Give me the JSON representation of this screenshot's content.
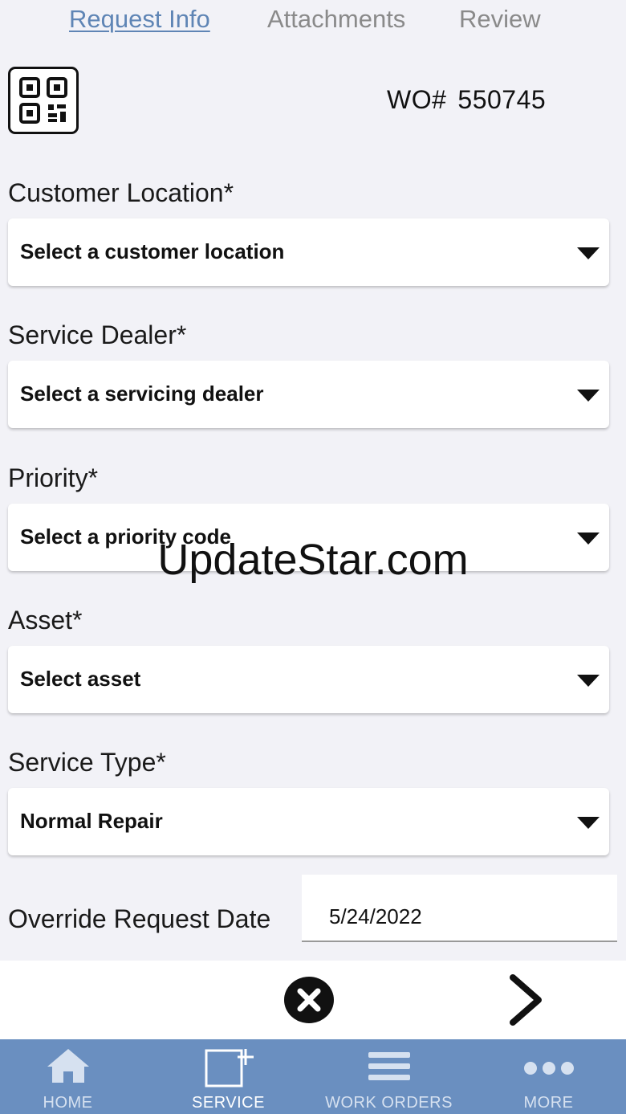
{
  "tabs": [
    {
      "label": "Request Info",
      "active": true
    },
    {
      "label": "Attachments",
      "active": false
    },
    {
      "label": "Review",
      "active": false
    }
  ],
  "header": {
    "qr_icon": "qr-code-icon",
    "wo_prefix": "WO#",
    "wo_number": "550745"
  },
  "form": {
    "customer_location": {
      "label": "Customer Location*",
      "value": "Select a customer location"
    },
    "service_dealer": {
      "label": "Service Dealer*",
      "value": "Select a servicing dealer"
    },
    "priority": {
      "label": "Priority*",
      "value": "Select a priority code"
    },
    "asset": {
      "label": "Asset*",
      "value": "Select asset"
    },
    "service_type": {
      "label": "Service Type*",
      "value": "Normal Repair"
    },
    "override_date": {
      "label": "Override Request Date",
      "value": "5/24/2022"
    }
  },
  "actions": {
    "cancel_icon": "close-circle-icon",
    "next_icon": "chevron-right-icon"
  },
  "nav": [
    {
      "label": "HOME",
      "icon": "home-icon",
      "active": false
    },
    {
      "label": "SERVICE",
      "icon": "new-service-icon",
      "active": true
    },
    {
      "label": "WORK ORDERS",
      "icon": "list-icon",
      "active": false
    },
    {
      "label": "MORE",
      "icon": "more-dots-icon",
      "active": false
    }
  ],
  "watermark": "UpdateStar.com",
  "colors": {
    "accent": "#5f85b5",
    "navbar": "#6a8fc0",
    "background": "#f2f2f7"
  }
}
